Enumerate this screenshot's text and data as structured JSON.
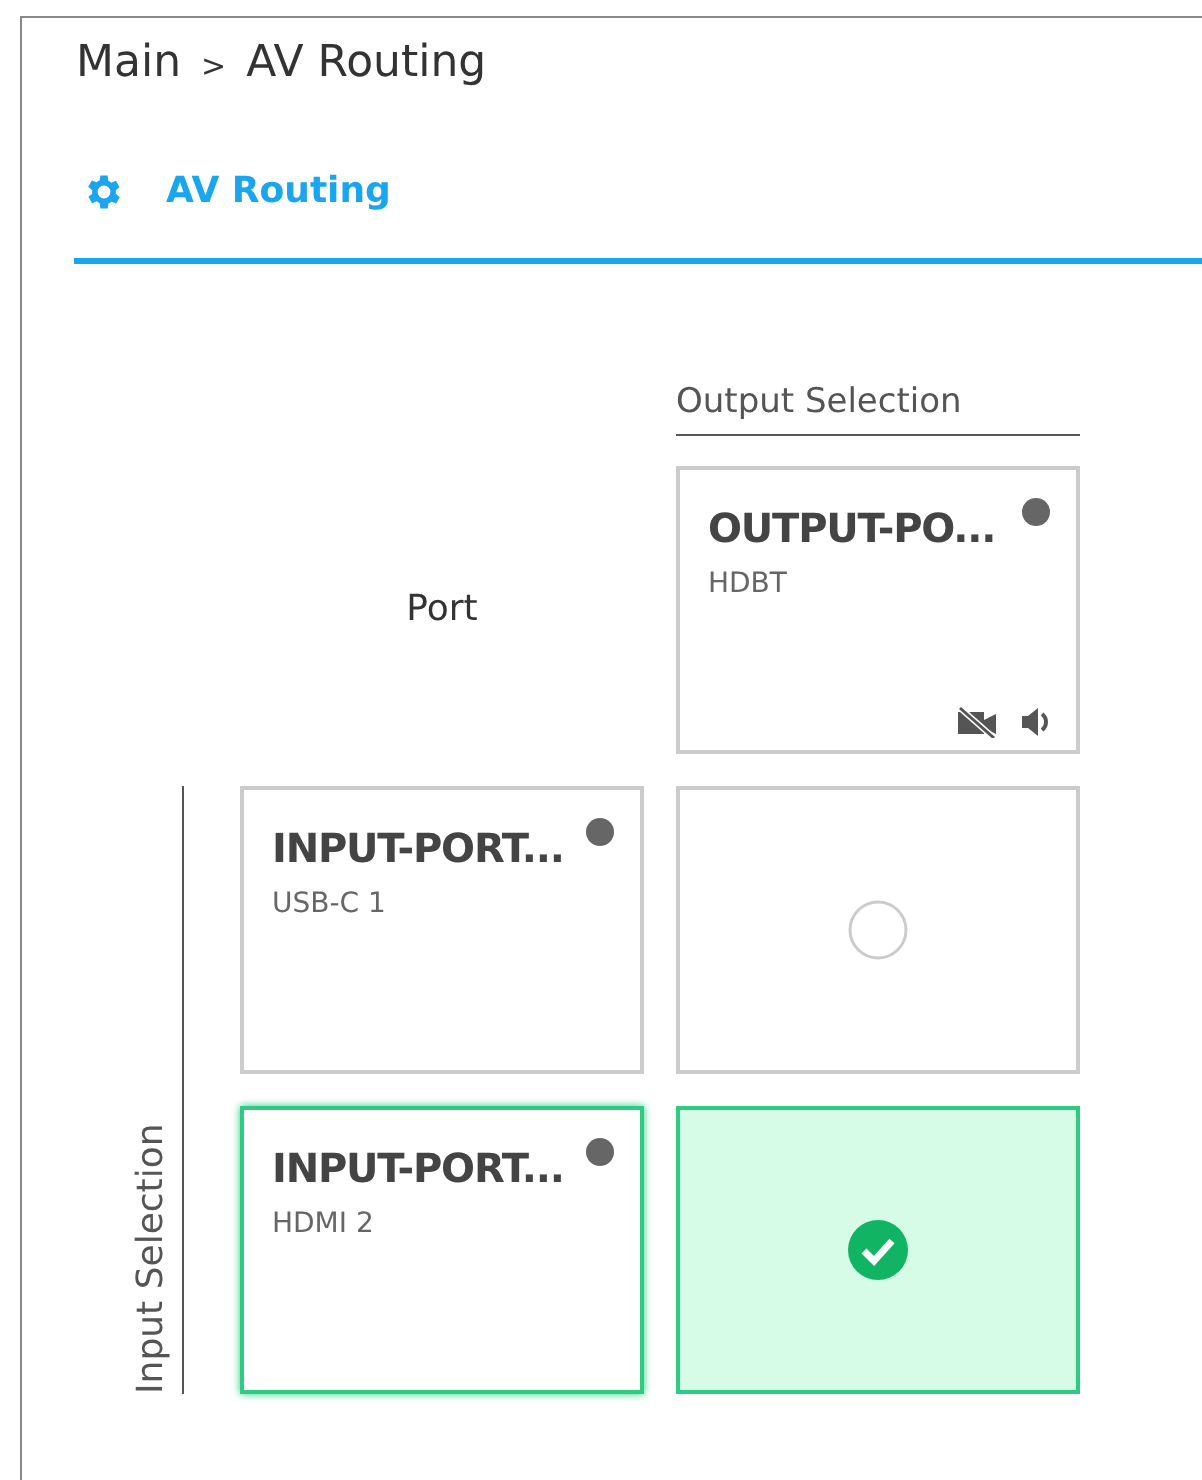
{
  "breadcrumb": {
    "items": [
      {
        "label": "Main"
      },
      {
        "label": "AV Routing"
      }
    ],
    "separator": ">"
  },
  "tabs": [
    {
      "label": "AV Routing",
      "selected": true
    }
  ],
  "matrix": {
    "output_header": "Output Selection",
    "port_label": "Port",
    "input_header": "Input Selection",
    "outputs": [
      {
        "name": "OUTPUT-PO...",
        "type": "HDBT",
        "video_muted": true,
        "audio_muted": false
      }
    ],
    "inputs": [
      {
        "name": "INPUT-PORT...",
        "type": "USB-C 1",
        "selected": false,
        "routes": [
          {
            "selected": false
          }
        ]
      },
      {
        "name": "INPUT-PORT...",
        "type": "HDMI 2",
        "selected": true,
        "routes": [
          {
            "selected": true
          }
        ]
      }
    ]
  }
}
